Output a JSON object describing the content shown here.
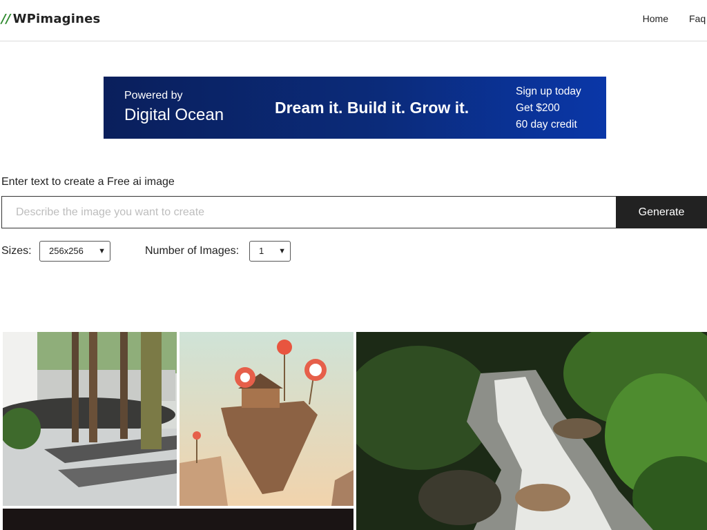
{
  "header": {
    "logo_slashes": "//",
    "logo_text": "WPimagines",
    "nav": {
      "home": "Home",
      "faq": "Faq"
    }
  },
  "banner": {
    "powered_by": "Powered by",
    "brand": "Digital Ocean",
    "tagline": "Dream it. Build it. Grow it.",
    "cta_line1": "Sign up today",
    "cta_line2": "Get $200",
    "cta_line3": "60 day credit"
  },
  "form": {
    "prompt_label": "Enter text to create a Free ai image",
    "input_value": "",
    "input_placeholder": "Describe the image you want to create",
    "generate_label": "Generate",
    "sizes_label": "Sizes:",
    "sizes_selected": "256x256",
    "count_label": "Number of Images:",
    "count_selected": "1"
  },
  "gallery": {
    "images": [
      "modern courtyard with trees",
      "floating island with candy lollipops",
      "forest waterfall stream",
      "dark image"
    ]
  }
}
